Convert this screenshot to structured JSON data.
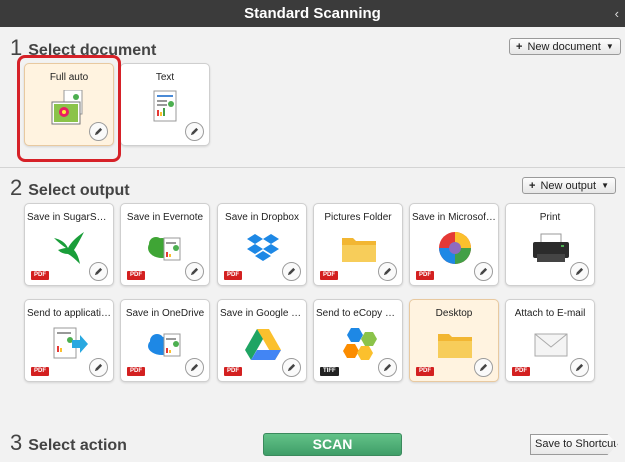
{
  "window": {
    "title": "Standard Scanning",
    "collapse_glyph": "‹"
  },
  "section1": {
    "number": "1",
    "label": "Select document",
    "new_button": "New document"
  },
  "section2": {
    "number": "2",
    "label": "Select output",
    "new_button": "New output"
  },
  "section3": {
    "number": "3",
    "label": "Select action"
  },
  "documents": [
    {
      "label": "Full auto",
      "icon": "full-auto-icon",
      "selected": true
    },
    {
      "label": "Text",
      "icon": "text-document-icon",
      "selected": false
    }
  ],
  "outputs": [
    {
      "label": "Save in SugarSync",
      "icon": "sugarsync-icon",
      "badge": "PDF"
    },
    {
      "label": "Save in Evernote",
      "icon": "evernote-icon",
      "badge": "PDF"
    },
    {
      "label": "Save in Dropbox",
      "icon": "dropbox-icon",
      "badge": "PDF"
    },
    {
      "label": "Pictures Folder",
      "icon": "folder-icon",
      "badge": "PDF"
    },
    {
      "label": "Save in Microsoft S...",
      "icon": "sharepoint-icon",
      "badge": "PDF"
    },
    {
      "label": "Print",
      "icon": "printer-icon",
      "badge": ""
    },
    {
      "label": "Send to application",
      "icon": "send-to-application-icon",
      "badge": "PDF"
    },
    {
      "label": "Save in OneDrive",
      "icon": "onedrive-icon",
      "badge": "PDF"
    },
    {
      "label": "Save in Google Dri...",
      "icon": "google-drive-icon",
      "badge": "PDF"
    },
    {
      "label": "Send to eCopy PD...",
      "icon": "ecopy-icon",
      "badge": "TIFF"
    },
    {
      "label": "Desktop",
      "icon": "folder-icon",
      "badge": "PDF",
      "selected": true
    },
    {
      "label": "Attach to E-mail",
      "icon": "email-icon",
      "badge": "PDF"
    }
  ],
  "actions": {
    "scan": "SCAN",
    "save_shortcut": "Save to Shortcut"
  },
  "colors": {
    "titlebar": "#3b3b3b",
    "scan": "#4caf76",
    "highlight": "#d62128",
    "pdf_badge": "#d32020"
  }
}
